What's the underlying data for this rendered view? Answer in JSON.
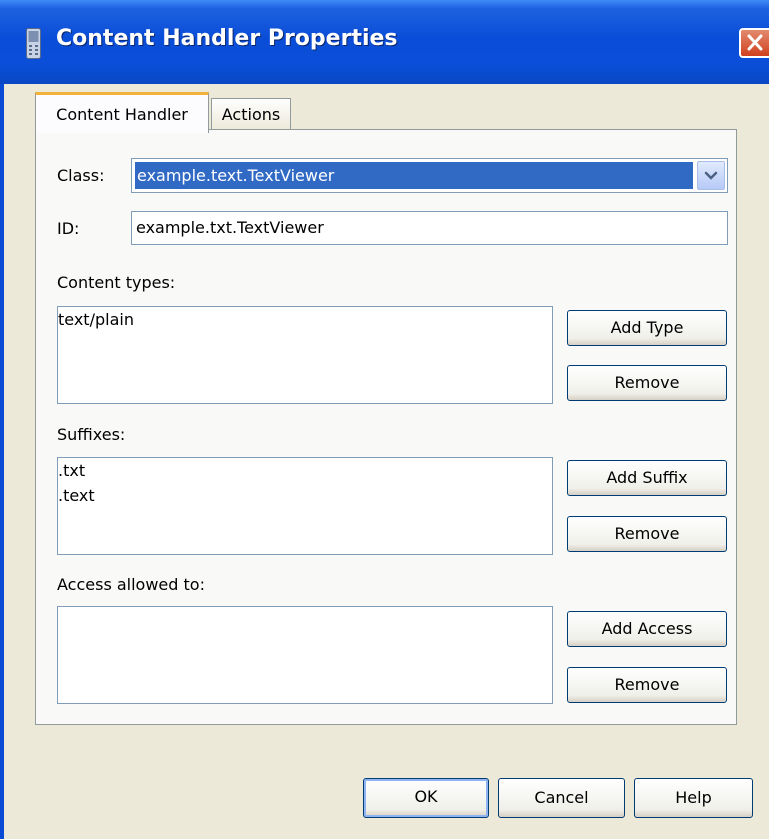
{
  "window": {
    "title": "Content Handler Properties",
    "icons": {
      "app": "phone-icon",
      "close": "close-icon",
      "dropdown": "chevron-down-icon"
    },
    "colors": {
      "titlebar": "#0b4fd9",
      "selection": "#316ac5",
      "active_tab_accent": "#f3b23c",
      "close_button": "#d0411e"
    }
  },
  "tabs": [
    {
      "label": "Content Handler",
      "selected": true
    },
    {
      "label": "Actions",
      "selected": false
    }
  ],
  "form": {
    "class_label": "Class:",
    "class_value": "example.text.TextViewer",
    "id_label": "ID:",
    "id_value": "example.txt.TextViewer"
  },
  "content_types": {
    "label": "Content types:",
    "items": [
      "text/plain"
    ],
    "add_label": "Add Type",
    "remove_label": "Remove"
  },
  "suffixes": {
    "label": "Suffixes:",
    "items": [
      ".txt",
      ".text"
    ],
    "add_label": "Add Suffix",
    "remove_label": "Remove"
  },
  "access": {
    "label": "Access allowed to:",
    "items": [],
    "add_label": "Add Access",
    "remove_label": "Remove"
  },
  "footer": {
    "ok_label": "OK",
    "cancel_label": "Cancel",
    "help_label": "Help"
  }
}
